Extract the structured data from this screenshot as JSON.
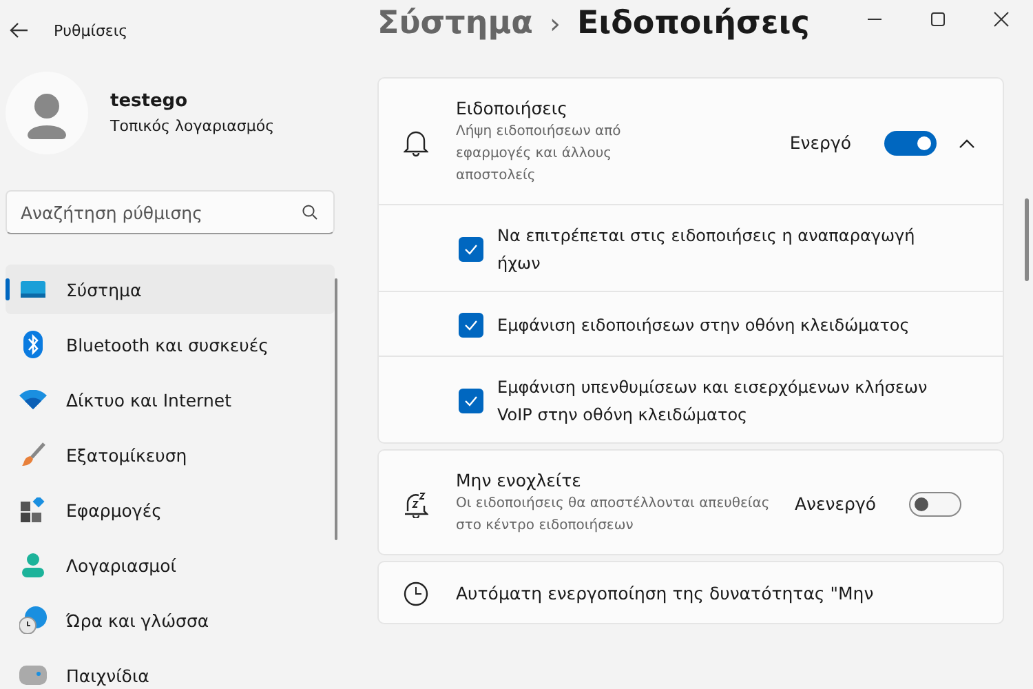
{
  "window": {
    "title": "Ρυθμίσεις"
  },
  "account": {
    "name": "testego",
    "type": "Τοπικός λογαριασμός"
  },
  "search": {
    "placeholder": "Αναζήτηση ρύθμισης"
  },
  "sidebar": {
    "items": [
      {
        "label": "Σύστημα",
        "selected": true
      },
      {
        "label": "Bluetooth και συσκευές",
        "selected": false
      },
      {
        "label": "Δίκτυο και Internet",
        "selected": false
      },
      {
        "label": "Εξατομίκευση",
        "selected": false
      },
      {
        "label": "Εφαρμογές",
        "selected": false
      },
      {
        "label": "Λογαριασμοί",
        "selected": false
      },
      {
        "label": "Ώρα και γλώσσα",
        "selected": false
      },
      {
        "label": "Παιχνίδια",
        "selected": false
      }
    ]
  },
  "breadcrumb": {
    "parent": "Σύστημα",
    "separator": "›",
    "current": "Ειδοποιήσεις"
  },
  "cards": [
    {
      "title": "Ειδοποιήσεις",
      "description": "Λήψη ειδοποιήσεων από εφαρμογές και άλλους αποστολείς",
      "state_label": "Ενεργό",
      "on": true,
      "expanded": true,
      "options": [
        {
          "label": "Να επιτρέπεται στις ειδοποιήσεις η αναπαραγωγή ήχων",
          "checked": true
        },
        {
          "label": "Εμφάνιση ειδοποιήσεων στην οθόνη κλειδώματος",
          "checked": true
        },
        {
          "label": "Εμφάνιση υπενθυμίσεων και εισερχόμενων κλήσεων VoIP στην οθόνη κλειδώματος",
          "checked": true
        }
      ]
    },
    {
      "title": "Μην ενοχλείτε",
      "description": "Οι ειδοποιήσεις θα αποστέλλονται απευθείας στο κέντρο ειδοποιήσεων",
      "state_label": "Ανενεργό",
      "on": false
    },
    {
      "title": "Αυτόματη ενεργοποίηση της δυνατότητας \"Μην"
    }
  ]
}
